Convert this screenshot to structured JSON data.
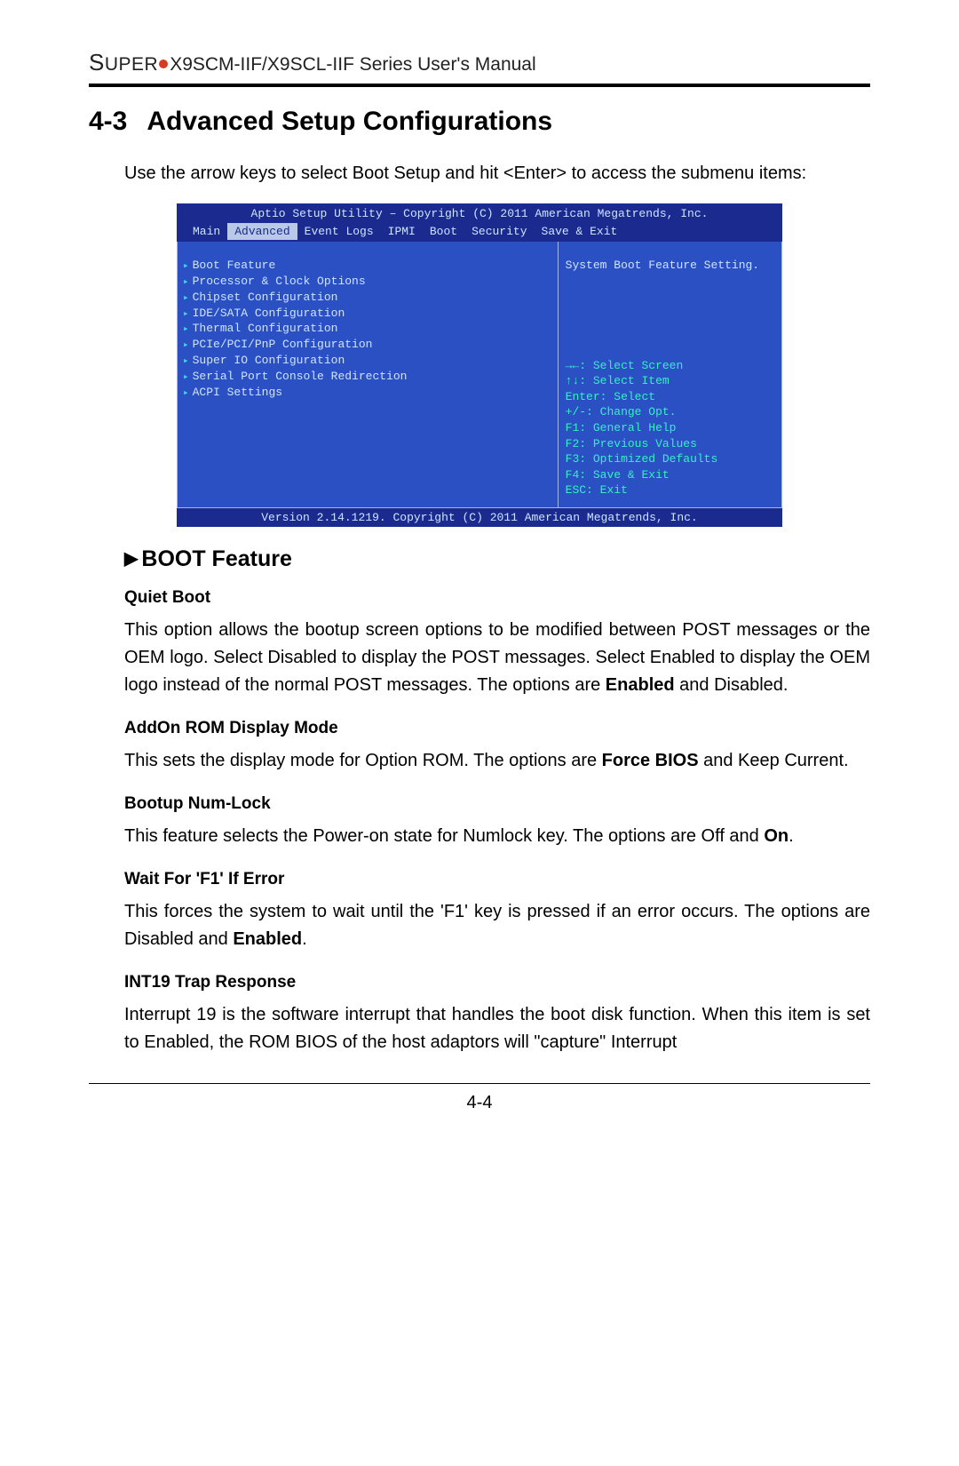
{
  "header": {
    "brand": "SUPER",
    "product": "X9SCM-IIF/X9SCL-IIF Series User's Manual"
  },
  "section": {
    "number": "4-3",
    "title": "Advanced Setup Configurations",
    "intro": "Use the arrow keys to select Boot Setup and hit <Enter> to access the submenu items:"
  },
  "bios": {
    "title": "Aptio Setup Utility – Copyright (C) 2011 American Megatrends, Inc.",
    "tabs": [
      "Main",
      "Advanced",
      "Event Logs",
      "IPMI",
      "Boot",
      "Security",
      "Save & Exit"
    ],
    "selected_tab": "Advanced",
    "items": [
      "Boot Feature",
      "Processor & Clock Options",
      "Chipset Configuration",
      "IDE/SATA Configuration",
      "Thermal Configuration",
      "PCIe/PCI/PnP Configuration",
      "Super IO Configuration",
      "Serial Port Console Redirection",
      "ACPI Settings"
    ],
    "right_hint_top": "System Boot Feature Setting.",
    "hints": "→←: Select Screen\n↑↓: Select Item\nEnter: Select\n+/-: Change Opt.\nF1: General Help\nF2: Previous Values\nF3: Optimized Defaults\nF4: Save & Exit\nESC: Exit",
    "footer": "Version 2.14.1219. Copyright (C) 2011 American Megatrends, Inc."
  },
  "subheading": "BOOT Feature",
  "options": [
    {
      "title": "Quiet Boot",
      "body_html": "This option allows the bootup screen options to be modified between POST messages or the OEM logo. Select Disabled to display the POST messages. Select Enabled to display the OEM logo instead of the normal POST messages. The options are <b>Enabled</b> and Disabled."
    },
    {
      "title": "AddOn ROM Display Mode",
      "body_html": "This sets the display mode for Option ROM. The options are <b>Force BIOS</b> and Keep Current."
    },
    {
      "title": "Bootup Num-Lock",
      "body_html": "This feature selects the Power-on state for Numlock key.  The options are Off and <b>On</b>."
    },
    {
      "title": "Wait For 'F1' If Error",
      "body_html": "This forces the system to wait until the 'F1' key is pressed if an error occurs.  The options are Disabled and <b>Enabled</b>."
    },
    {
      "title": "INT19 Trap Response",
      "body_html": "Interrupt 19 is the software interrupt that handles the boot disk function. When this item is set to Enabled, the ROM BIOS of the host adaptors will \"capture\" Interrupt"
    }
  ],
  "page_number": "4-4"
}
